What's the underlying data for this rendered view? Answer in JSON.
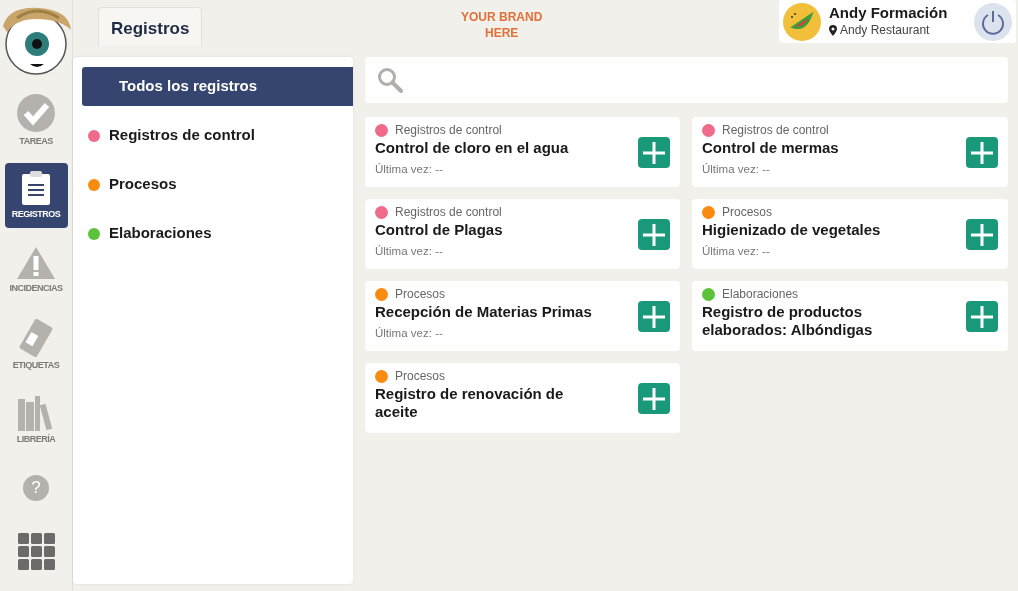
{
  "header": {
    "tab": "Registros",
    "brand": "YOUR BRAND\nHERE",
    "user": {
      "name": "Andy Formación",
      "place": "Andy Restaurant"
    }
  },
  "nav": [
    {
      "label": "TAREAS",
      "selected": false
    },
    {
      "label": "REGISTROS",
      "selected": true
    },
    {
      "label": "INCIDENCIAS",
      "selected": false
    },
    {
      "label": "ETIQUETAS",
      "selected": false
    },
    {
      "label": "LIBRERÍA",
      "selected": false
    }
  ],
  "help": "?",
  "filters": [
    {
      "label": "Todos los registros",
      "selected": true
    },
    {
      "label": "Registros de control",
      "selected": false,
      "color": "#f06a8c"
    },
    {
      "label": "Procesos",
      "selected": false,
      "color": "#f98c10"
    },
    {
      "label": "Elaboraciones",
      "selected": false,
      "color": "#5cc23a"
    }
  ],
  "cards": [
    {
      "category": "Registros de control",
      "color": "#f06a8c",
      "title": "Control de cloro en el agua",
      "last": "Última vez: --"
    },
    {
      "category": "Registros de control",
      "color": "#f06a8c",
      "title": "Control de mermas",
      "last": "Última vez: --"
    },
    {
      "category": "Registros de control",
      "color": "#f06a8c",
      "title": "Control de Plagas",
      "last": "Última vez: --"
    },
    {
      "category": "Procesos",
      "color": "#f98c10",
      "title": "Higienizado de vegetales",
      "last": "Última vez: --"
    },
    {
      "category": "Procesos",
      "color": "#f98c10",
      "title": "Recepción de Materias Primas",
      "last": "Última vez: --"
    },
    {
      "category": "Elaboraciones",
      "color": "#5cc23a",
      "title": "Registro de productos elaborados: Albóndigas"
    },
    {
      "category": "Procesos",
      "color": "#f98c10",
      "title": "Registro de renovación de aceite"
    }
  ]
}
